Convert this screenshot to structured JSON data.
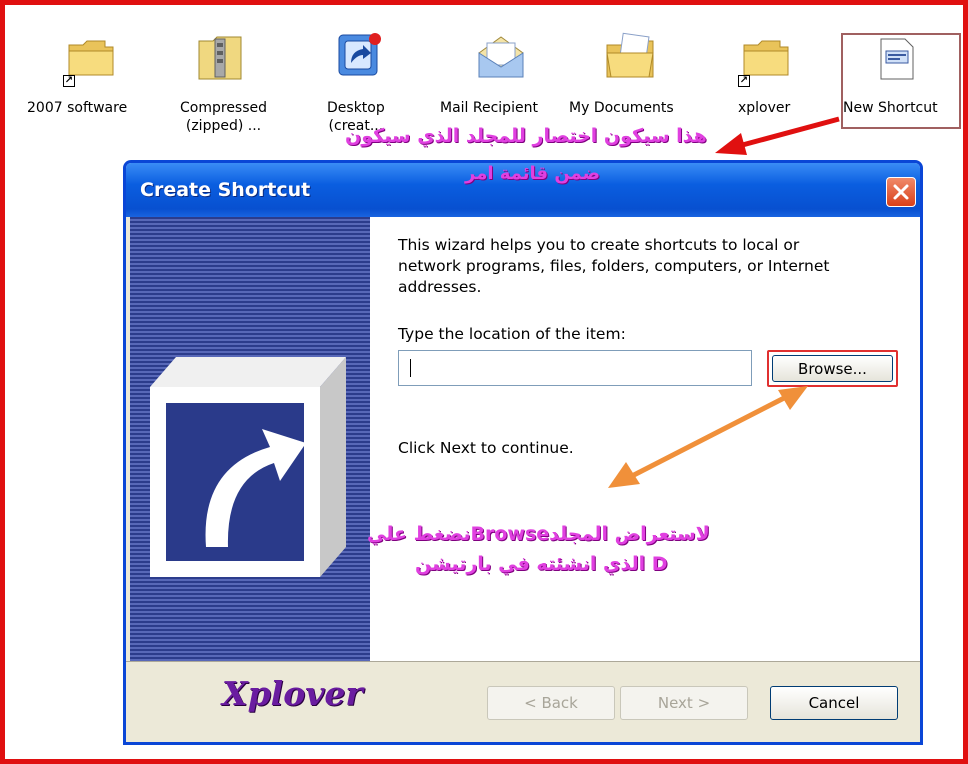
{
  "desktop_icons": [
    {
      "label_lines": [
        "2007 software"
      ],
      "icon": "folder-shortcut-icon"
    },
    {
      "label_lines": [
        "Compressed",
        "(zipped) ..."
      ],
      "icon": "zip-folder-icon"
    },
    {
      "label_lines": [
        "Desktop",
        "(creat..."
      ],
      "icon": "desktop-shortcut-icon"
    },
    {
      "label_lines": [
        "Mail Recipient"
      ],
      "icon": "mail-icon"
    },
    {
      "label_lines": [
        "My Documents"
      ],
      "icon": "my-documents-icon"
    },
    {
      "label_lines": [
        "xplover"
      ],
      "icon": "folder-shortcut-icon"
    },
    {
      "label_lines": [
        "New Shortcut"
      ],
      "icon": "shortcut-file-icon"
    }
  ],
  "annotations": {
    "top_line1": "هذا سيكون اختصار للمجلد الذي سيكون",
    "top_line2": "ضمن قائمة امر",
    "bottom_line1": "نضغط عليBrowseلاستعراض المجلد",
    "bottom_line2": "الذي انشئته في بارتيشن   D"
  },
  "dialog": {
    "title": "Create Shortcut",
    "intro": "This wizard helps you to create shortcuts to local or network programs, files, folders, computers, or Internet addresses.",
    "location_label": "Type the location of the item:",
    "location_value": "",
    "browse_label": "Browse...",
    "next_hint": "Click Next to continue.",
    "back_label": "< Back",
    "next_label": "Next >",
    "cancel_label": "Cancel",
    "watermark": "Xplover"
  },
  "colors": {
    "frame_border": "#e01010",
    "annotation": "#e040e0",
    "arrow_red": "#e01010",
    "arrow_orange": "#f0903a",
    "titlebar": "#0a5ee0"
  }
}
